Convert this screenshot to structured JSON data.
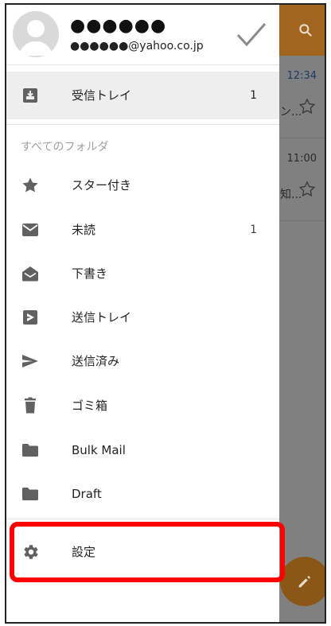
{
  "colors": {
    "accent": "#a0661f",
    "highlight": "#ff0000",
    "icon": "#616161"
  },
  "account": {
    "name": "●●●●●●",
    "email": "●●●●●●@yahoo.co.jp"
  },
  "background_mail": [
    {
      "time": "12:34",
      "snippet": "ン..."
    },
    {
      "time": "11:00",
      "snippet": "知..."
    }
  ],
  "drawer": {
    "inbox": {
      "label": "受信トレイ",
      "count": "1",
      "icon": "inbox-icon"
    },
    "section_label": "すべてのフォルダ",
    "items": [
      {
        "label": "スター付き",
        "count": "",
        "icon": "star-icon"
      },
      {
        "label": "未読",
        "count": "1",
        "icon": "mail-icon"
      },
      {
        "label": "下書き",
        "count": "",
        "icon": "draft-icon"
      },
      {
        "label": "送信トレイ",
        "count": "",
        "icon": "outbox-icon"
      },
      {
        "label": "送信済み",
        "count": "",
        "icon": "send-icon"
      },
      {
        "label": "ゴミ箱",
        "count": "",
        "icon": "trash-icon"
      },
      {
        "label": "Bulk Mail",
        "count": "",
        "icon": "folder-icon"
      },
      {
        "label": "Draft",
        "count": "",
        "icon": "folder-icon"
      }
    ],
    "settings": {
      "label": "設定",
      "icon": "gear-icon"
    }
  }
}
